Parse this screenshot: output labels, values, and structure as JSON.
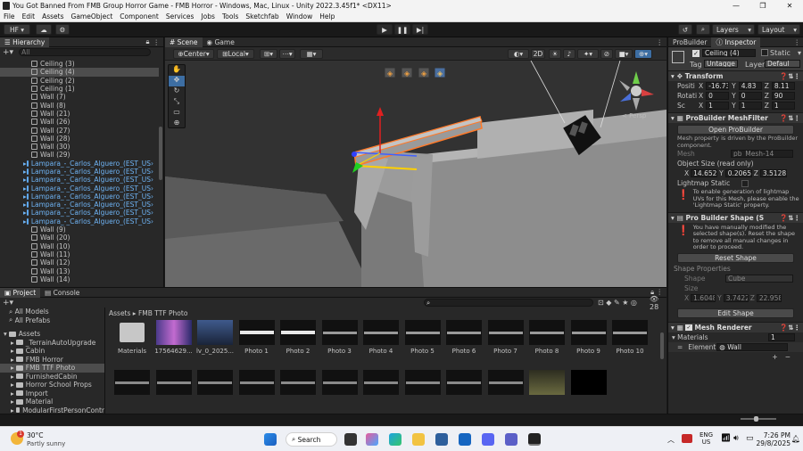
{
  "window": {
    "title": "You Got Banned From FMB Group Horror Game - FMB Horror - Windows, Mac, Linux - Unity 2022.3.45f1* <DX11>",
    "controls": [
      "—",
      "❐",
      "✕"
    ]
  },
  "menu": [
    "File",
    "Edit",
    "Assets",
    "GameObject",
    "Component",
    "Services",
    "Jobs",
    "Tools",
    "Sketchfab",
    "Window",
    "Help"
  ],
  "toolbar": {
    "account": "HF ▾",
    "layers": "Layers",
    "layout": "Layout"
  },
  "hierarchy": {
    "tab": "Hierarchy",
    "search_placeholder": "All",
    "rows": [
      {
        "label": "Ceiling (3)",
        "prefab": false,
        "selected": false
      },
      {
        "label": "Ceiling (4)",
        "prefab": false,
        "selected": true
      },
      {
        "label": "Ceiling (2)",
        "prefab": false,
        "selected": false
      },
      {
        "label": "Ceiling (1)",
        "prefab": false,
        "selected": false
      },
      {
        "label": "Wall (7)",
        "prefab": false,
        "selected": false
      },
      {
        "label": "Wall (8)",
        "prefab": false,
        "selected": false
      },
      {
        "label": "Wall (21)",
        "prefab": false,
        "selected": false
      },
      {
        "label": "Wall (26)",
        "prefab": false,
        "selected": false
      },
      {
        "label": "Wall (27)",
        "prefab": false,
        "selected": false
      },
      {
        "label": "Wall (28)",
        "prefab": false,
        "selected": false
      },
      {
        "label": "Wall (30)",
        "prefab": false,
        "selected": false
      },
      {
        "label": "Wall (29)",
        "prefab": false,
        "selected": false
      },
      {
        "label": "Lampara_-_Carlos_Alguero_(EST_US",
        "prefab": true,
        "selected": false
      },
      {
        "label": "Lampara_-_Carlos_Alguero_(EST_US",
        "prefab": true,
        "selected": false
      },
      {
        "label": "Lampara_-_Carlos_Alguero_(EST_US",
        "prefab": true,
        "selected": false
      },
      {
        "label": "Lampara_-_Carlos_Alguero_(EST_US",
        "prefab": true,
        "selected": false
      },
      {
        "label": "Lampara_-_Carlos_Alguero_(EST_US",
        "prefab": true,
        "selected": false
      },
      {
        "label": "Lampara_-_Carlos_Alguero_(EST_US",
        "prefab": true,
        "selected": false
      },
      {
        "label": "Lampara_-_Carlos_Alguero_(EST_US",
        "prefab": true,
        "selected": false
      },
      {
        "label": "Lampara_-_Carlos_Alguero_(EST_US",
        "prefab": true,
        "selected": false
      },
      {
        "label": "Wall (9)",
        "prefab": false,
        "selected": false
      },
      {
        "label": "Wall (20)",
        "prefab": false,
        "selected": false
      },
      {
        "label": "Wall (10)",
        "prefab": false,
        "selected": false
      },
      {
        "label": "Wall (11)",
        "prefab": false,
        "selected": false
      },
      {
        "label": "Wall (12)",
        "prefab": false,
        "selected": false
      },
      {
        "label": "Wall (13)",
        "prefab": false,
        "selected": false
      },
      {
        "label": "Wall (14)",
        "prefab": false,
        "selected": false
      }
    ]
  },
  "scene": {
    "tabs": [
      "Scene",
      "Game"
    ],
    "pivot": "Center",
    "space": "Local",
    "mode_2d": "2D",
    "persp": "< Persp"
  },
  "inspector": {
    "tabs": [
      "ProBuilder",
      "Inspector"
    ],
    "object_name": "Ceiling (4)",
    "static": "Static",
    "tag_label": "Tag",
    "tag": "Untagge",
    "layer_label": "Layer",
    "layer": "Defaul",
    "transform": {
      "title": "Transform",
      "position_label": "Positi",
      "rotation_label": "Rotati",
      "scale_label": "Sc",
      "position": [
        "-16.73",
        "4.83",
        "8.11"
      ],
      "rotation": [
        "0",
        "0",
        "90"
      ],
      "scale": [
        "1",
        "1",
        "1"
      ]
    },
    "meshfilter": {
      "title": "ProBuilder MeshFilter",
      "button": "Open ProBuilder",
      "note": "Mesh property is driven by the ProBuilder component.",
      "mesh_label": "Mesh",
      "mesh_value": "pb_Mesh-14",
      "size_label": "Object Size (read only)",
      "size": [
        "14.6524",
        "0.20655",
        "3.51289"
      ],
      "lightmap_label": "Lightmap Static",
      "lightmap_help": "To enable generation of lightmap UVs for this Mesh, please enable the 'Lightmap Static' property."
    },
    "shape": {
      "title": "Pro Builder Shape (S",
      "warning": "You have manually modified the selected shape(s). Reset the shape to remove all manual changes in order to proceed.",
      "reset": "Reset Shape",
      "props_label": "Shape Properties",
      "shape_label": "Shape",
      "shape_value": "Cube",
      "size_label": "Size",
      "size": [
        "1.6048",
        "3.7422",
        "22.958"
      ],
      "edit": "Edit Shape"
    },
    "renderer": {
      "title": "Mesh Renderer",
      "materials_label": "Materials",
      "materials_count": "1",
      "element_label": "Element",
      "element_value": "Wall"
    }
  },
  "project": {
    "tabs": [
      "Project",
      "Console"
    ],
    "favorites": [
      "All Models",
      "All Prefabs"
    ],
    "tree": [
      {
        "label": "Assets",
        "indent": 0,
        "selected": false
      },
      {
        "label": "_TerrainAutoUpgrade",
        "indent": 1,
        "selected": false
      },
      {
        "label": "Cabin",
        "indent": 1,
        "selected": false
      },
      {
        "label": "FMB Horror",
        "indent": 1,
        "selected": false
      },
      {
        "label": "FMB TTF Photo",
        "indent": 1,
        "selected": true
      },
      {
        "label": "FurnishedCabin",
        "indent": 1,
        "selected": false
      },
      {
        "label": "Horror School Props",
        "indent": 1,
        "selected": false
      },
      {
        "label": "Import",
        "indent": 1,
        "selected": false
      },
      {
        "label": "Material",
        "indent": 1,
        "selected": false
      },
      {
        "label": "ModularFirstPersonContr",
        "indent": 1,
        "selected": false
      }
    ],
    "breadcrumb": [
      "Assets",
      "FMB TTF Photo"
    ],
    "count": "28",
    "assets_row1": [
      "Materials",
      "17564629...",
      "lv_0_2025...",
      "Photo 1",
      "Photo 2",
      "Photo 3",
      "Photo 4",
      "Photo 5",
      "Photo 6",
      "Photo 7",
      "Photo 8",
      "Photo 9",
      "Photo 10"
    ]
  },
  "taskbar": {
    "weather_temp": "30°C",
    "weather_desc": "Partly sunny",
    "weather_badge": "1",
    "search": "Search",
    "lang1": "ENG",
    "lang2": "US",
    "time": "7:26 PM",
    "date": "29/8/2025"
  }
}
